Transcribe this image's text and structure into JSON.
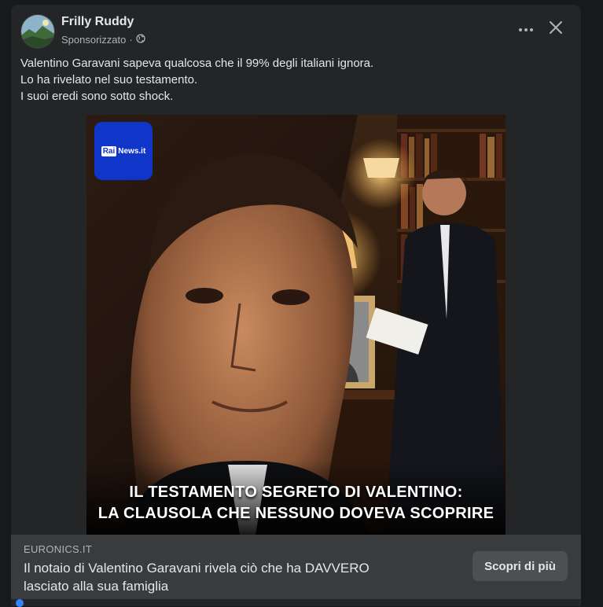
{
  "post": {
    "author": "Frilly Ruddy",
    "sponsored_label": "Sponsorizzato",
    "separator": "·",
    "text_lines": [
      "Valentino Garavani sapeva qualcosa che il 99% degli italiani ignora.",
      "Lo ha rivelato nel suo testamento.",
      "I suoi eredi sono sotto shock."
    ]
  },
  "image": {
    "logo_rai": "Rai",
    "logo_news": "News.it",
    "headline_lines": [
      "IL TESTAMENTO SEGRETO DI VALENTINO:",
      "LA CLAUSOLA CHE NESSUNO DOVEVA SCOPRIRE"
    ]
  },
  "link": {
    "domain": "EURONICS.IT",
    "title_line1": "Il notaio di Valentino Garavani rivela ciò che ha DAVVERO",
    "title_line2": "lasciato alla sua famiglia",
    "cta_label": "Scopri di più"
  },
  "icons": {
    "more": "more-horizontal-icon",
    "close": "close-icon",
    "privacy": "globe-icon"
  },
  "colors": {
    "card_bg": "#242526",
    "link_bar_bg": "#3a3b3c",
    "logo_blue": "#0f35c9"
  }
}
